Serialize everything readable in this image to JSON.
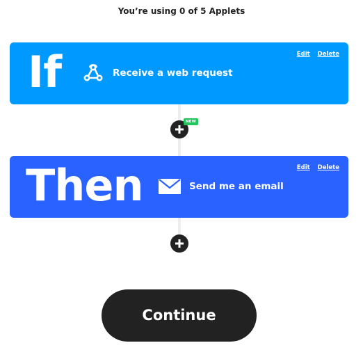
{
  "usage_text": "You’re using 0 of 5 Applets",
  "if_card": {
    "keyword": "If",
    "service_label": "Receive a web request",
    "icon": "webhook-icon",
    "edit_label": "Edit",
    "delete_label": "Delete",
    "color": "#0099ff"
  },
  "then_card": {
    "keyword": "Then",
    "service_label": "Send me an email",
    "icon": "email-icon",
    "edit_label": "Edit",
    "delete_label": "Delete",
    "color": "#2962ff"
  },
  "new_badge": "NEW",
  "continue_label": "Continue",
  "colors": {
    "dark": "#222222",
    "badge_green": "#22c55e",
    "connector": "#eeeeee"
  }
}
